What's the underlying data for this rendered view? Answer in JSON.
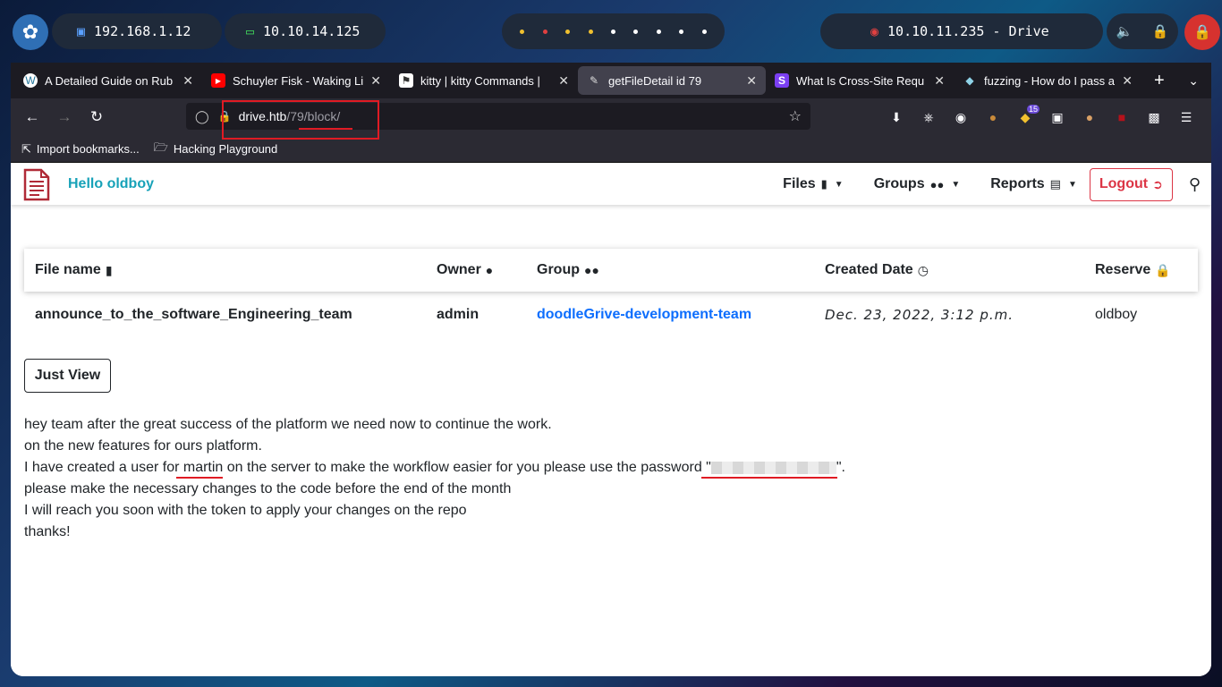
{
  "desktop": {
    "ip_local": "192.168.1.12",
    "ip_vpn": "10.10.14.125",
    "target": "10.10.11.235 - Drive"
  },
  "browser": {
    "tabs": [
      {
        "label": "A Detailed Guide on Rub",
        "icon": "wordpress-icon"
      },
      {
        "label": "Schuyler Fisk - Waking Li",
        "icon": "youtube-icon"
      },
      {
        "label": "kitty | kitty Commands |",
        "icon": "kitty-icon"
      },
      {
        "label": "getFileDetail id 79",
        "icon": "document-icon",
        "active": true
      },
      {
        "label": "What Is Cross-Site Requ",
        "icon": "s-icon"
      },
      {
        "label": "fuzzing - How do I pass a",
        "icon": "stack-icon"
      }
    ],
    "url_host": "drive.htb",
    "url_path": "/79/block/",
    "bookmarks": [
      "Import bookmarks...",
      "Hacking Playground"
    ],
    "extension_badge": "15"
  },
  "site": {
    "brand": "Hello oldboy",
    "menu": {
      "files": "Files",
      "groups": "Groups",
      "reports": "Reports",
      "logout": "Logout"
    },
    "table": {
      "headers": {
        "file_name": "File name",
        "owner": "Owner",
        "group": "Group",
        "created_date": "Created Date",
        "reserve": "Reserve"
      },
      "row": {
        "file_name": "announce_to_the_software_Engineering_team",
        "owner": "admin",
        "group": "doodleGrive-development-team",
        "created_date": "Dec. 23, 2022, 3:12 p.m.",
        "reserve": "oldboy"
      }
    },
    "view_button": "Just View",
    "message": {
      "line1": "hey team after the great success of the platform we need now to continue the work.",
      "line2": "on the new features for ours platform.",
      "line3_a": "I have created a user for ",
      "line3_user": "martin",
      "line3_b": " on the server to make the workflow easier for you please use the password \"",
      "line3_c": "\".",
      "line4": "please make the necessary changes to the code before the end of the month",
      "line5": "I will reach you soon with the token to apply your changes on the repo",
      "line6": "thanks!"
    }
  }
}
